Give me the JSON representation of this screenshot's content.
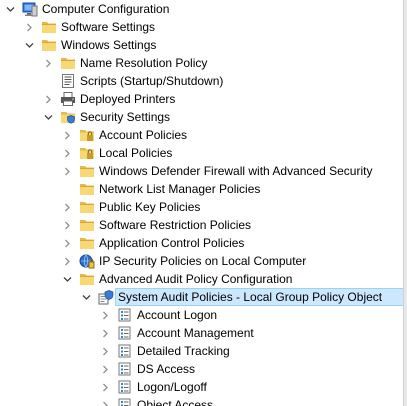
{
  "tree": [
    {
      "label": "Computer Configuration",
      "icon": "computer-icon",
      "level": 0,
      "expander": "expanded"
    },
    {
      "label": "Software Settings",
      "icon": "folder-icon",
      "level": 1,
      "expander": "collapsed"
    },
    {
      "label": "Windows Settings",
      "icon": "folder-icon",
      "level": 1,
      "expander": "expanded"
    },
    {
      "label": "Name Resolution Policy",
      "icon": "folder-icon",
      "level": 2,
      "expander": "collapsed"
    },
    {
      "label": "Scripts (Startup/Shutdown)",
      "icon": "script-icon",
      "level": 2,
      "expander": "none"
    },
    {
      "label": "Deployed Printers",
      "icon": "printer-icon",
      "level": 2,
      "expander": "collapsed"
    },
    {
      "label": "Security Settings",
      "icon": "security-settings-icon",
      "level": 2,
      "expander": "expanded"
    },
    {
      "label": "Account Policies",
      "icon": "locked-folder-icon",
      "level": 3,
      "expander": "collapsed"
    },
    {
      "label": "Local Policies",
      "icon": "locked-folder-icon",
      "level": 3,
      "expander": "collapsed"
    },
    {
      "label": "Windows Defender Firewall with Advanced Security",
      "icon": "folder-icon",
      "level": 3,
      "expander": "collapsed"
    },
    {
      "label": "Network List Manager Policies",
      "icon": "folder-icon",
      "level": 3,
      "expander": "none"
    },
    {
      "label": "Public Key Policies",
      "icon": "folder-icon",
      "level": 3,
      "expander": "collapsed"
    },
    {
      "label": "Software Restriction Policies",
      "icon": "folder-icon",
      "level": 3,
      "expander": "collapsed"
    },
    {
      "label": "Application Control Policies",
      "icon": "folder-icon",
      "level": 3,
      "expander": "collapsed"
    },
    {
      "label": "IP Security Policies on Local Computer",
      "icon": "ip-security-icon",
      "level": 3,
      "expander": "collapsed"
    },
    {
      "label": "Advanced Audit Policy Configuration",
      "icon": "folder-icon",
      "level": 3,
      "expander": "expanded"
    },
    {
      "label": "System Audit Policies - Local Group Policy Object",
      "icon": "audit-policy-icon",
      "level": 4,
      "expander": "expanded",
      "selected": true
    },
    {
      "label": "Account Logon",
      "icon": "audit-category-icon",
      "level": 5,
      "expander": "collapsed"
    },
    {
      "label": "Account Management",
      "icon": "audit-category-icon",
      "level": 5,
      "expander": "collapsed"
    },
    {
      "label": "Detailed Tracking",
      "icon": "audit-category-icon",
      "level": 5,
      "expander": "collapsed"
    },
    {
      "label": "DS Access",
      "icon": "audit-category-icon",
      "level": 5,
      "expander": "collapsed"
    },
    {
      "label": "Logon/Logoff",
      "icon": "audit-category-icon",
      "level": 5,
      "expander": "collapsed"
    },
    {
      "label": "Object Access",
      "icon": "audit-category-icon",
      "level": 5,
      "expander": "collapsed"
    }
  ],
  "colors": {
    "selection_bg": "#cce8ff",
    "selection_border": "#99d1ff",
    "folder_yellow": "#f8d775",
    "chevron": "#606060"
  }
}
